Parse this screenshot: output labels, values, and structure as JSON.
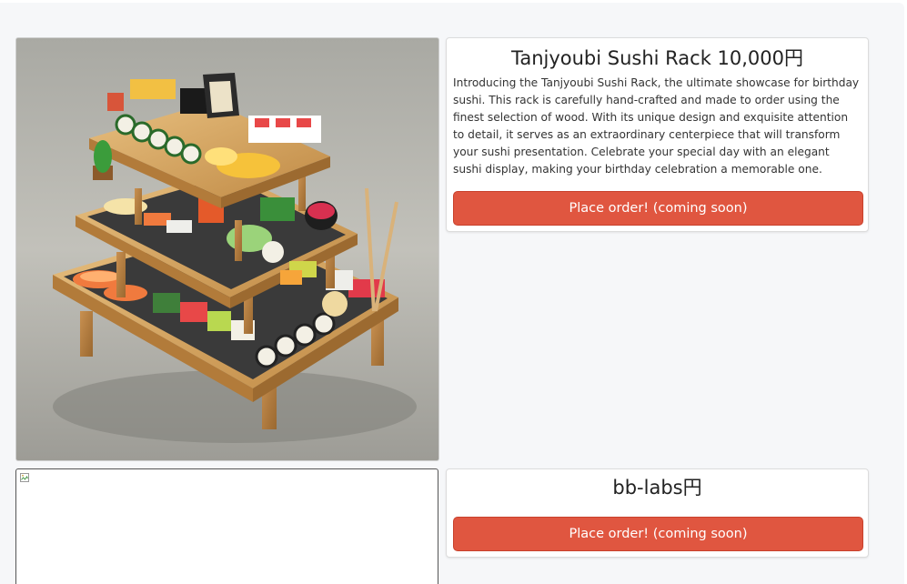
{
  "products": [
    {
      "title": "Tanjyoubi Sushi Rack 10,000円",
      "description": "Introducing the Tanjyoubi Sushi Rack, the ultimate showcase for birthday sushi. This rack is carefully hand-crafted and made to order using the finest selection of wood. With its unique design and exquisite attention to detail, it serves as an extraordinary centerpiece that will transform your sushi presentation. Celebrate your special day with an elegant sushi display, making your birthday celebration a memorable one.",
      "button_label": "Place order! (coming soon)",
      "image": "sushi-rack-photo"
    },
    {
      "title": "bb-labs円",
      "button_label": "Place order! (coming soon)",
      "image": "broken-image-icon"
    }
  ],
  "colors": {
    "button": "#e05640",
    "background": "#f6f7f9",
    "card": "#ffffff"
  }
}
